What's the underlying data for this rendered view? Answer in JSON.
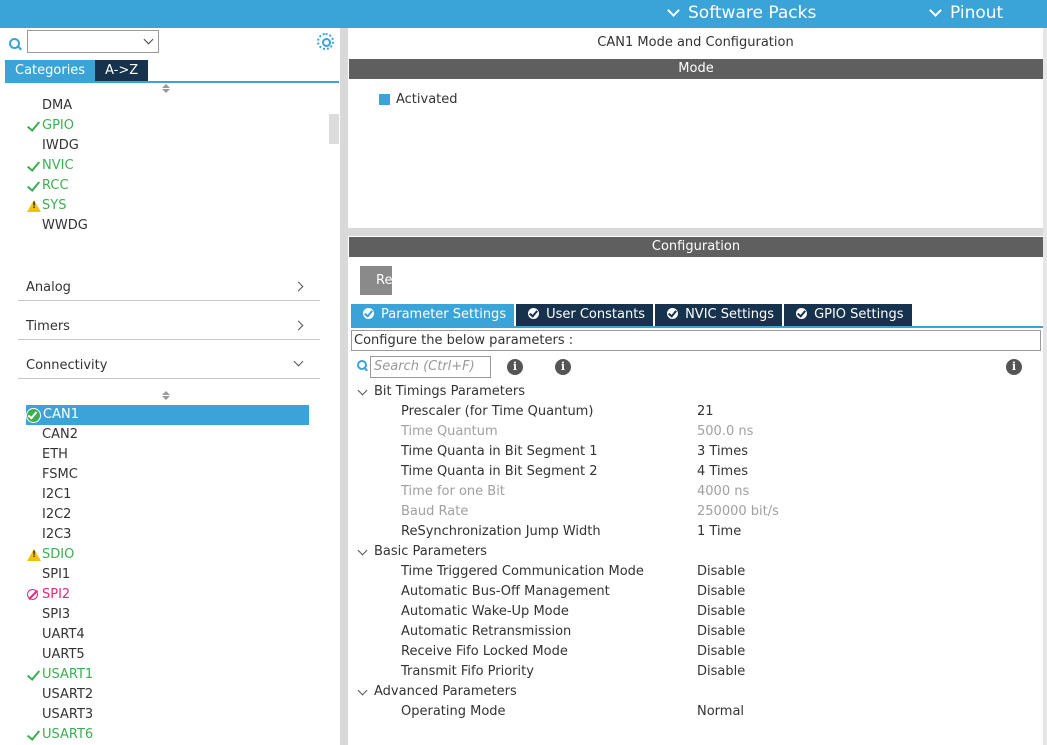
{
  "topbar": {
    "software_packs": "Software Packs",
    "pinout": "Pinout"
  },
  "left": {
    "search_value": "",
    "tabs": [
      "Categories",
      "A->Z"
    ],
    "system_items": [
      {
        "label": "DMA",
        "status": "none"
      },
      {
        "label": "GPIO",
        "status": "ok"
      },
      {
        "label": "IWDG",
        "status": "none"
      },
      {
        "label": "NVIC",
        "status": "ok"
      },
      {
        "label": "RCC",
        "status": "ok"
      },
      {
        "label": "SYS",
        "status": "warning"
      },
      {
        "label": "WWDG",
        "status": "none"
      }
    ],
    "categories": [
      "Analog",
      "Timers",
      "Connectivity"
    ],
    "connectivity_items": [
      {
        "label": "CAN1",
        "status": "selected-ok"
      },
      {
        "label": "CAN2",
        "status": "none"
      },
      {
        "label": "ETH",
        "status": "none"
      },
      {
        "label": "FSMC",
        "status": "none"
      },
      {
        "label": "I2C1",
        "status": "none"
      },
      {
        "label": "I2C2",
        "status": "none"
      },
      {
        "label": "I2C3",
        "status": "none"
      },
      {
        "label": "SDIO",
        "status": "warning"
      },
      {
        "label": "SPI1",
        "status": "none"
      },
      {
        "label": "SPI2",
        "status": "forbidden"
      },
      {
        "label": "SPI3",
        "status": "none"
      },
      {
        "label": "UART4",
        "status": "none"
      },
      {
        "label": "UART5",
        "status": "none"
      },
      {
        "label": "USART1",
        "status": "ok"
      },
      {
        "label": "USART2",
        "status": "none"
      },
      {
        "label": "USART3",
        "status": "none"
      },
      {
        "label": "USART6",
        "status": "ok"
      }
    ]
  },
  "right": {
    "title": "CAN1 Mode and Configuration",
    "mode_bar": "Mode",
    "activated_label": "Activated",
    "config_bar": "Configuration",
    "reset_button": "Re",
    "config_tabs": [
      "Parameter Settings",
      "User Constants",
      "NVIC Settings",
      "GPIO Settings"
    ],
    "configure_text": "Configure the below parameters :",
    "search_placeholder": "Search (Ctrl+F)",
    "info_glyph": "i",
    "groups": [
      {
        "name": "Bit Timings Parameters",
        "params": [
          {
            "name": "Prescaler (for Time Quantum)",
            "value": "21",
            "editable": true
          },
          {
            "name": "Time Quantum",
            "value": "500.0 ns",
            "editable": false
          },
          {
            "name": "Time Quanta in Bit Segment 1",
            "value": "3 Times",
            "editable": true
          },
          {
            "name": "Time Quanta in Bit Segment 2",
            "value": "4 Times",
            "editable": true
          },
          {
            "name": "Time for one Bit",
            "value": "4000 ns",
            "editable": false
          },
          {
            "name": "Baud Rate",
            "value": "250000 bit/s",
            "editable": false
          },
          {
            "name": "ReSynchronization Jump Width",
            "value": "1 Time",
            "editable": true
          }
        ]
      },
      {
        "name": "Basic Parameters",
        "params": [
          {
            "name": "Time Triggered Communication Mode",
            "value": "Disable",
            "editable": true
          },
          {
            "name": "Automatic Bus-Off Management",
            "value": "Disable",
            "editable": true
          },
          {
            "name": "Automatic Wake-Up Mode",
            "value": "Disable",
            "editable": true
          },
          {
            "name": "Automatic Retransmission",
            "value": "Disable",
            "editable": true
          },
          {
            "name": "Receive Fifo Locked Mode",
            "value": "Disable",
            "editable": true
          },
          {
            "name": "Transmit Fifo Priority",
            "value": "Disable",
            "editable": true
          }
        ]
      },
      {
        "name": "Advanced Parameters",
        "params": [
          {
            "name": "Operating Mode",
            "value": "Normal",
            "editable": true
          }
        ]
      }
    ]
  },
  "colors": {
    "accent": "#3aa3d8",
    "dark_tab": "#17324d",
    "ok": "#3dae52",
    "warning": "#f2c200",
    "error": "#e0287a",
    "bar_gray": "#5f5f5f"
  }
}
